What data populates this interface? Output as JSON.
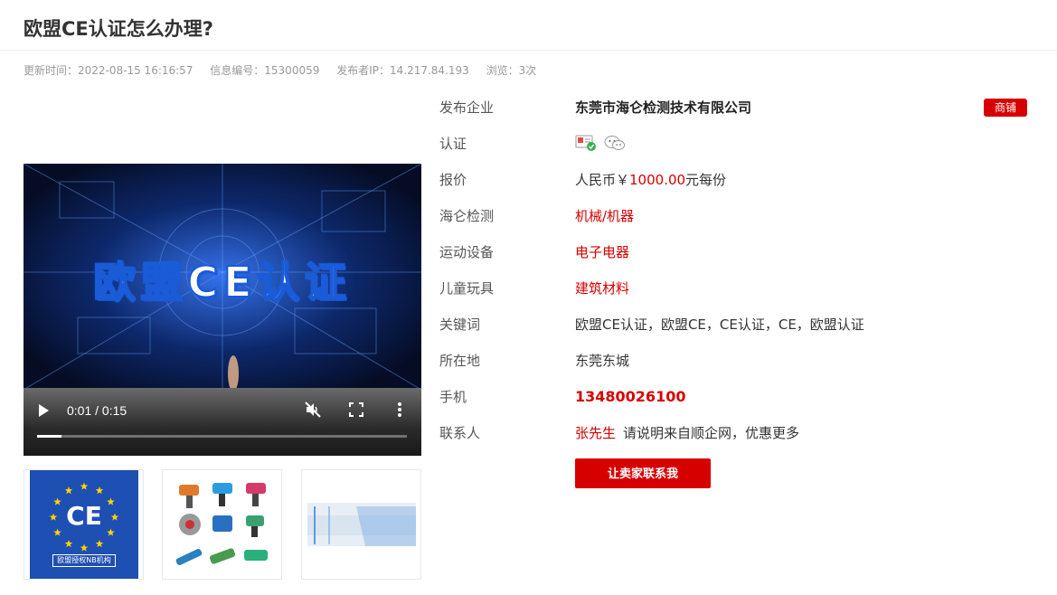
{
  "title": "欧盟CE认证怎么办理?",
  "meta": {
    "updated": "更新时间：2022-08-15 16:16:57",
    "info_id": "信息编号：15300059",
    "ip": "发布者IP：14.217.84.193",
    "views": "浏览：3次"
  },
  "video": {
    "banner": "欧盟CE认证",
    "time": "0:01 / 0:15",
    "progress": 0.067
  },
  "thumbs": {
    "ce_mark": "CE",
    "ce_caption": "欧盟授权NB机构"
  },
  "info": {
    "company_label": "发布企业",
    "company": "东莞市海仑检测技术有限公司",
    "shop_badge": "商铺",
    "cert_label": "认证",
    "price_label": "报价",
    "price_prefix": "人民币￥",
    "price_value": "1000.00",
    "price_suffix": "元每份",
    "cat1_label": "海仑检测",
    "cat1_value": "机械/机器",
    "cat2_label": "运动设备",
    "cat2_value": "电子电器",
    "cat3_label": "儿童玩具",
    "cat3_value": "建筑材料",
    "keywords_label": "关键词",
    "keywords": "欧盟CE认证，欧盟CE，CE认证，CE，欧盟认证",
    "location_label": "所在地",
    "location": "东莞东城",
    "phone_label": "手机",
    "phone": "13480026100",
    "contact_label": "联系人",
    "contact_name": "张先生",
    "contact_note": "请说明来自顺企网，优惠更多",
    "contact_button": "让卖家联系我"
  },
  "icons": [
    "play-icon",
    "mute-icon",
    "fullscreen-icon",
    "more-icon",
    "id-verified-icon",
    "wechat-icon"
  ],
  "colors": {
    "accent": "#d70000",
    "ce_blue": "#1e4fb3"
  }
}
